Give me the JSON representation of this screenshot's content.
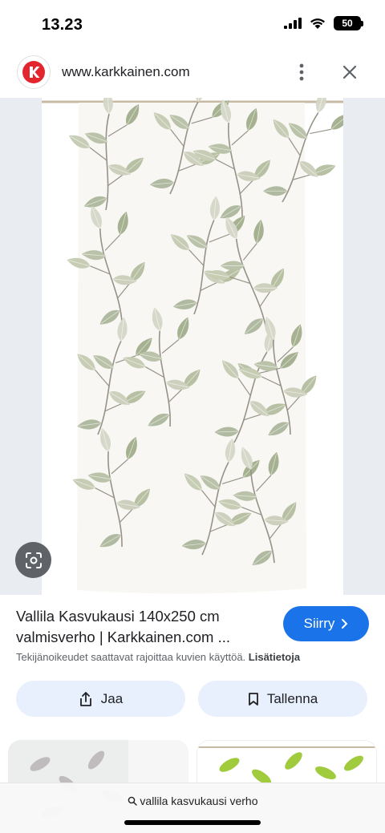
{
  "status_bar": {
    "time": "13.23",
    "battery": "50"
  },
  "browser": {
    "url": "www.karkkainen.com",
    "logo_letter": "K"
  },
  "result": {
    "title": "Vallila Kasvukausi 140x250 cm valmisverho | Karkkainen.com ...",
    "go_label": "Siirry",
    "copyright_text": "Tekijänoikeudet saattavat rajoittaa kuvien käyttöä.",
    "more_info": "Lisätietoja"
  },
  "actions": {
    "share_label": "Jaa",
    "save_label": "Tallenna"
  },
  "search": {
    "query": "vallila kasvukausi verho"
  },
  "colors": {
    "accent": "#1a73e8",
    "brand": "#e3262d",
    "button_bg": "#e8f0fe",
    "leaf": "#a9b592"
  },
  "icons": [
    "signal-icon",
    "wifi-icon",
    "battery-icon",
    "menu-dots-icon",
    "close-icon",
    "lens-icon",
    "share-icon",
    "bookmark-icon",
    "chevron-right-icon",
    "search-icon"
  ]
}
